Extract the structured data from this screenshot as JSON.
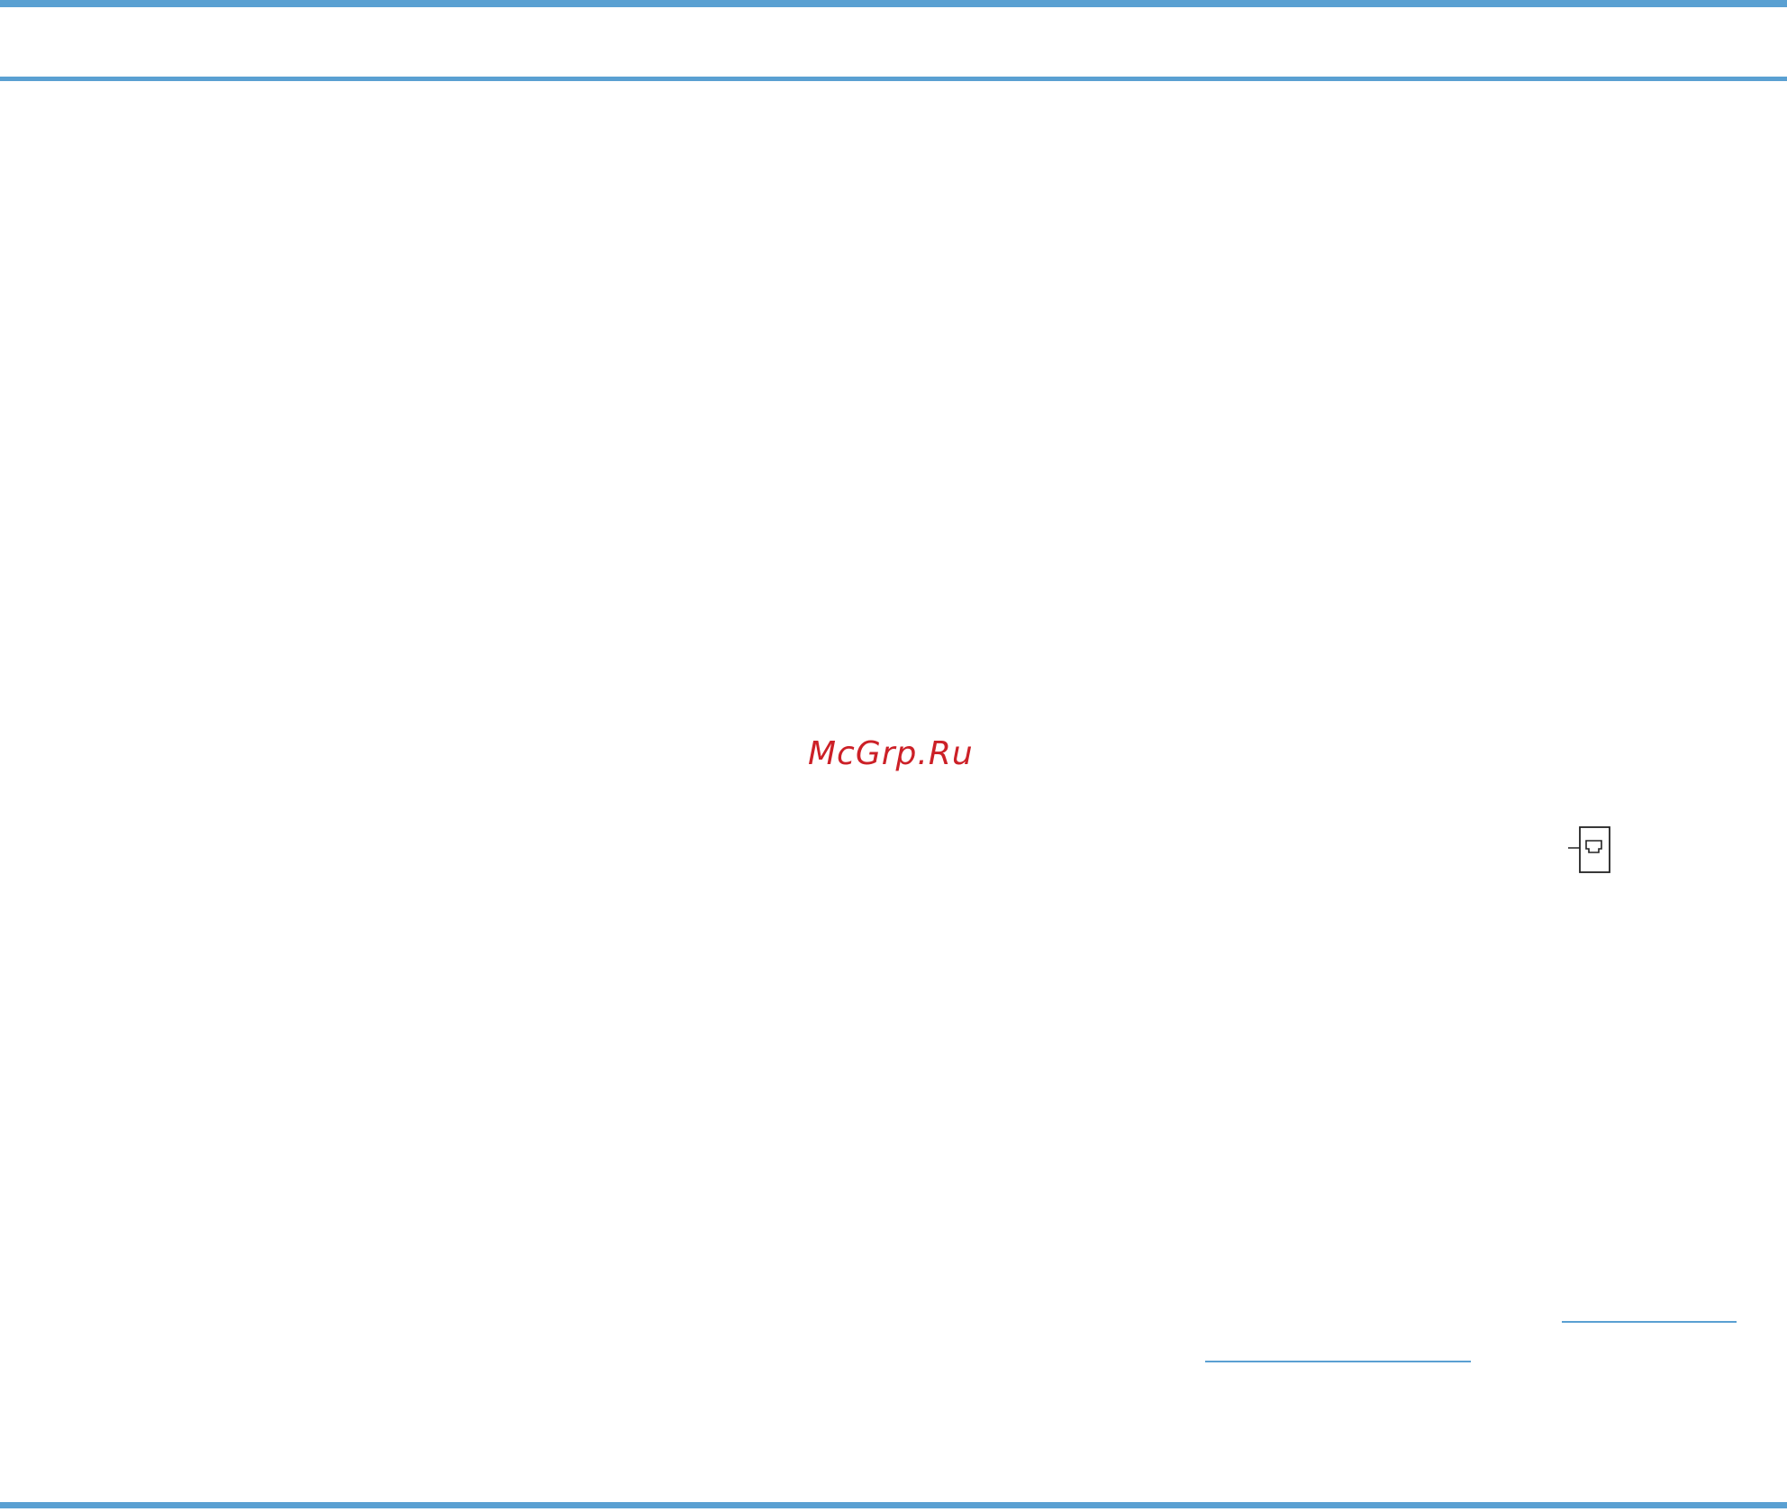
{
  "watermark": {
    "text": "McGrp.Ru",
    "color": "#cc2027"
  },
  "accent_color": "#5aa0d2",
  "icons": {
    "telephone_jack": "phone-jack-icon"
  }
}
